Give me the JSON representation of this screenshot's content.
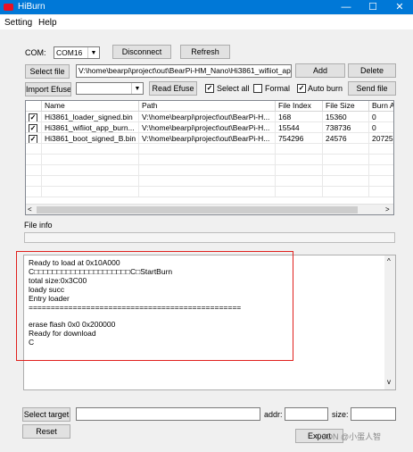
{
  "window": {
    "title": "HiBurn",
    "minimize": "—",
    "maximize": "☐",
    "close": "✕"
  },
  "menu": {
    "setting": "Setting",
    "help": "Help"
  },
  "com": {
    "label": "COM:",
    "value": "COM16",
    "disconnect": "Disconnect",
    "refresh": "Refresh"
  },
  "select_file": {
    "button": "Select file",
    "path": "V:\\home\\bearpi\\project\\out\\BearPi-HM_Nano\\Hi3861_wifiiot_app_",
    "add": "Add",
    "delete": "Delete"
  },
  "efuse": {
    "import": "Import Efuse",
    "read": "Read Efuse",
    "select_all": "Select all",
    "formal": "Formal",
    "auto_burn": "Auto burn",
    "send_file": "Send file"
  },
  "table": {
    "headers": [
      "",
      "Name",
      "Path",
      "File Index",
      "File Size",
      "Burn A"
    ],
    "rows": [
      {
        "checked": "✓",
        "name": "Hi3861_loader_signed.bin",
        "path": "V:\\home\\bearpi\\project\\out\\BearPi-H...",
        "index": "168",
        "size": "15360",
        "burn": "0"
      },
      {
        "checked": "✓",
        "name": "Hi3861_wifiiot_app_burn...",
        "path": "V:\\home\\bearpi\\project\\out\\BearPi-H...",
        "index": "15544",
        "size": "738736",
        "burn": "0"
      },
      {
        "checked": "✓",
        "name": "Hi3861_boot_signed_B.bin",
        "path": "V:\\home\\bearpi\\project\\out\\BearPi-H...",
        "index": "754296",
        "size": "24576",
        "burn": "20725"
      }
    ]
  },
  "scroll": {
    "left": "<",
    "right": ">",
    "up": "^",
    "down": "v"
  },
  "file_info": {
    "label": "File info"
  },
  "log": {
    "lines": [
      "Ready to load at 0x10A000",
      "C□□□□□□□□□□□□□□□□□□□□□C□StartBurn",
      "total size:0x3C00",
      "loady succ",
      "Entry loader",
      "================================================",
      "",
      "erase flash 0x0 0x200000",
      "Ready for download",
      "C"
    ]
  },
  "bottom": {
    "select_target": "Select target",
    "addr": "addr:",
    "size": "size:",
    "reset": "Reset",
    "export": "Export"
  },
  "watermark": "CSDN @小蛋人智"
}
